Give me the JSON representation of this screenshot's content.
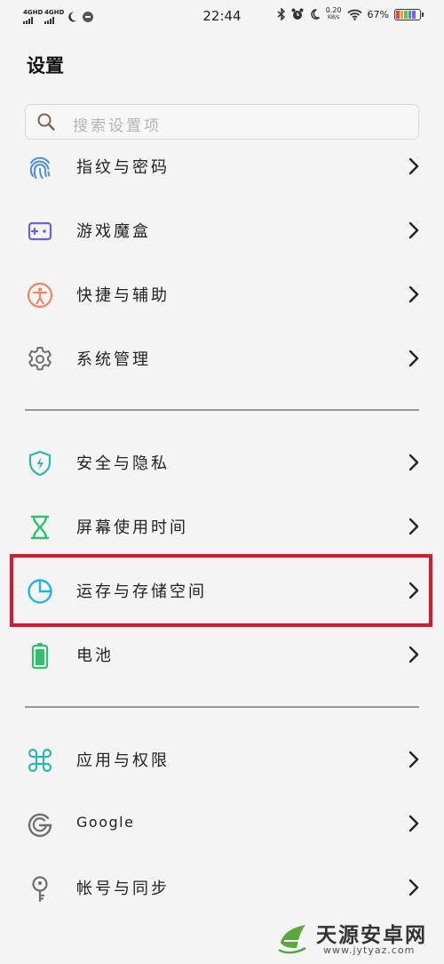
{
  "status_bar": {
    "net1": "4GHD",
    "net2": "4GHD",
    "time": "22:44",
    "speed_value": "0.20",
    "speed_unit": "KB/s",
    "battery": "67%"
  },
  "header": {
    "title": "设置"
  },
  "search": {
    "placeholder": "搜索设置项"
  },
  "groups": [
    {
      "items": [
        {
          "label": "指纹与密码",
          "icon": "fingerprint-icon"
        },
        {
          "label": "游戏魔盒",
          "icon": "game-box-icon"
        },
        {
          "label": "快捷与辅助",
          "icon": "accessibility-icon"
        },
        {
          "label": "系统管理",
          "icon": "gear-icon"
        }
      ]
    },
    {
      "items": [
        {
          "label": "安全与隐私",
          "icon": "shield-icon"
        },
        {
          "label": "屏幕使用时间",
          "icon": "hourglass-icon"
        },
        {
          "label": "运存与存储空间",
          "icon": "pie-chart-icon"
        },
        {
          "label": "电池",
          "icon": "battery-icon"
        }
      ]
    },
    {
      "items": [
        {
          "label": "应用与权限",
          "icon": "apps-icon"
        },
        {
          "label": "Google",
          "icon": "google-icon"
        },
        {
          "label": "帐号与同步",
          "icon": "key-icon"
        }
      ]
    }
  ],
  "colors": {
    "highlight": "#e0142a",
    "icon_blue": "#4a8fe0",
    "icon_purple": "#6a63d6",
    "icon_orange": "#f08462",
    "icon_gray": "#6f6f6f",
    "icon_teal": "#2fb6b2",
    "icon_green": "#2fbf6e",
    "icon_cyan": "#21b6de"
  },
  "watermark": {
    "name": "天源安卓网",
    "url": "www.jytyaz.com"
  }
}
